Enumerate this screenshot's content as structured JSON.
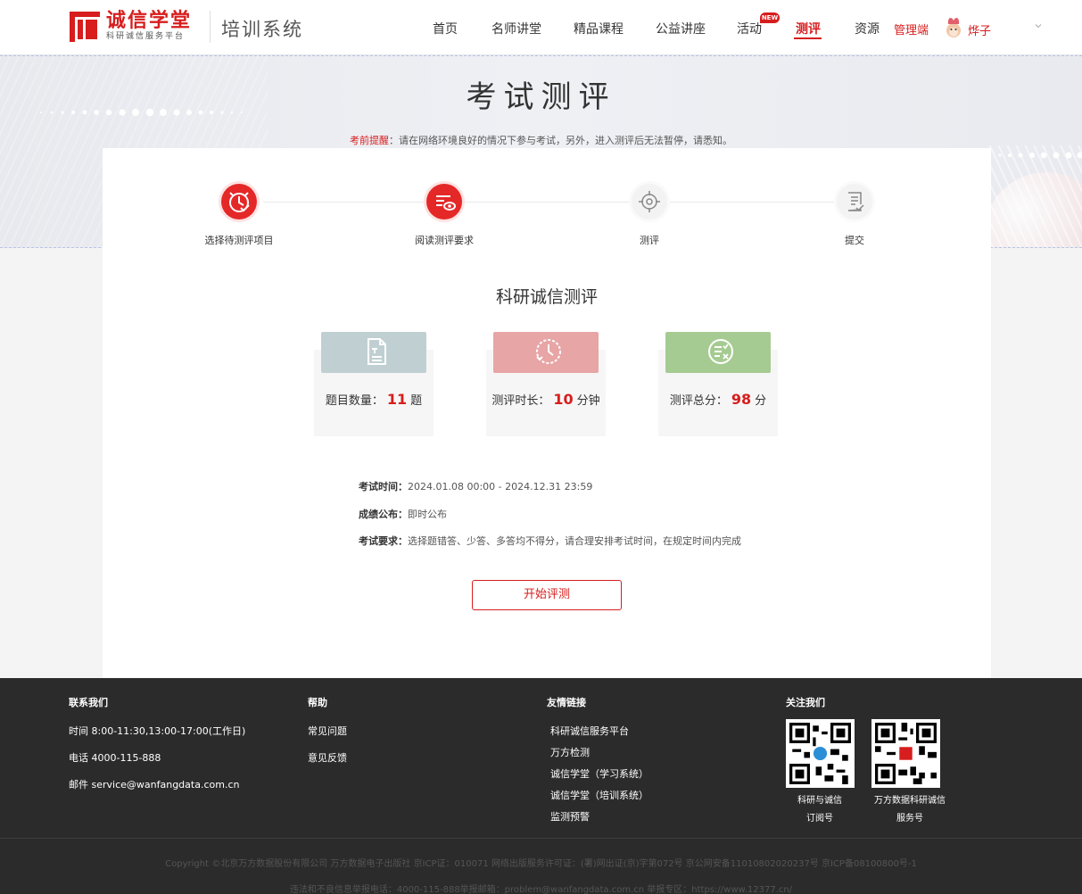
{
  "header": {
    "logo_title": "诚信学堂",
    "logo_sub": "科研诚信服务平台",
    "system_name": "培训系统",
    "nav": [
      {
        "label": "首页"
      },
      {
        "label": "名师讲堂"
      },
      {
        "label": "精品课程"
      },
      {
        "label": "公益讲座"
      },
      {
        "label": "活动"
      },
      {
        "label": "测评"
      },
      {
        "label": "资源"
      }
    ],
    "new_badge": "NEW",
    "admin_label": "管理端",
    "user_name": "烨子"
  },
  "banner": {
    "title": "考试测评",
    "notice_key": "考前提醒",
    "notice_text": "：请在网络环境良好的情况下参与考试，另外，进入测评后无法暂停，请悉知。"
  },
  "steps": [
    {
      "label": "选择待测评项目",
      "state": "done"
    },
    {
      "label": "阅读测评要求",
      "state": "current"
    },
    {
      "label": "测评",
      "state": "todo"
    },
    {
      "label": "提交",
      "state": "todo"
    }
  ],
  "exam": {
    "title": "科研诚信测评",
    "boxes": [
      {
        "prefix": "题目数量：",
        "value": "11",
        "unit": "题",
        "color": "#c0d0d2"
      },
      {
        "prefix": "测评时长：",
        "value": "10",
        "unit": "分钟",
        "color": "#e8a5a5"
      },
      {
        "prefix": "测评总分：",
        "value": "98",
        "unit": "分",
        "color": "#a6cb92"
      }
    ],
    "details": [
      {
        "key": "考试时间：",
        "value": "2024.01.08 00:00 - 2024.12.31 23:59"
      },
      {
        "key": "成绩公布：",
        "value": "即时公布"
      },
      {
        "key": "考试要求：",
        "value": "选择题错答、少答、多答均不得分，请合理安排考试时间，在规定时间内完成"
      }
    ],
    "start_label": "开始评测"
  },
  "footer": {
    "contact": {
      "title": "联系我们",
      "lines": [
        "时间 8:00-11:30,13:00-17:00(工作日)",
        "电话 4000-115-888",
        "邮件 service@wanfangdata.com.cn"
      ]
    },
    "help": {
      "title": "帮助",
      "links": [
        "常见问题",
        "意见反馈"
      ]
    },
    "friends": {
      "title": "友情链接",
      "links": [
        "科研诚信服务平台",
        "万方检测",
        "诚信学堂（学习系统）",
        "诚信学堂（培训系统）",
        "监测预警"
      ]
    },
    "follow": {
      "title": "关注我们",
      "qrs": [
        {
          "caption1": "科研与诚信",
          "caption2": "订阅号"
        },
        {
          "caption1": "万方数据科研诚信",
          "caption2": "服务号"
        }
      ]
    },
    "copyright": "Copyright ©北京万方数据股份有限公司  万方数据电子出版社  京ICP证：010071  网络出版服务许可证：(署)网出证(京)字第072号  京公网安备11010802020237号  京ICP备08100800号-1",
    "report": "违法和不良信息举报电话：4000-115-888举报邮箱：problem@wanfangdata.com.cn 举报专区：https://www.12377.cn/"
  },
  "colors": {
    "brand": "#d71d1d"
  }
}
